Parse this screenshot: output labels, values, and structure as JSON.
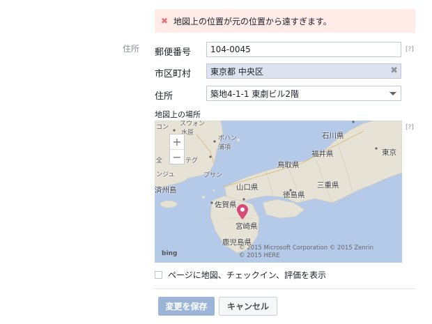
{
  "error": {
    "message": "地図上の位置が元の位置から遠すぎます。"
  },
  "section_label": "住所",
  "form": {
    "postal": {
      "label": "郵便番号",
      "value": "104-0045"
    },
    "city": {
      "label": "市区町村",
      "value": "東京都 中央区"
    },
    "address": {
      "label": "住所",
      "value": "築地4-1-1 東劇ビル2階"
    },
    "help": "[?]"
  },
  "map": {
    "label": "地図上の場所",
    "zoom_in": "+",
    "zoom_out": "−",
    "places": {
      "suwon": "スウォン",
      "suigen": "水原",
      "pohan": "ポハン",
      "hoko": "浦項",
      "tegu": "テグ",
      "pusan": "プサン",
      "jeonju": "全",
      "kunsan": "ンジュ",
      "kon": "コン",
      "jeju": "済州島",
      "ishikawa": "石川県",
      "fukui": "福井県",
      "tokyo": "東京",
      "tottori": "鳥取県",
      "yamaguchi": "山口県",
      "mie": "三重県",
      "tokushima": "徳島県",
      "saga": "佐賀県",
      "miyazaki": "宮崎県",
      "kagoshima": "鹿児島県"
    },
    "brand": "bing",
    "copyright_line1": "© 2015 Microsoft Corporation   © 2015 Zenrin",
    "copyright_line2": "© 2015 HERE"
  },
  "checkbox_label": "ページに地図、チェックイン、評価を表示",
  "buttons": {
    "save": "変更を保存",
    "cancel": "キャンセル"
  },
  "colors": {
    "error_bg": "#ffebe8",
    "error_icon": "#e9707b",
    "save_btn": "#9cb4d8",
    "water": "#b5c9e8",
    "land": "#e6e2d6",
    "pin": "#d64a7a"
  }
}
